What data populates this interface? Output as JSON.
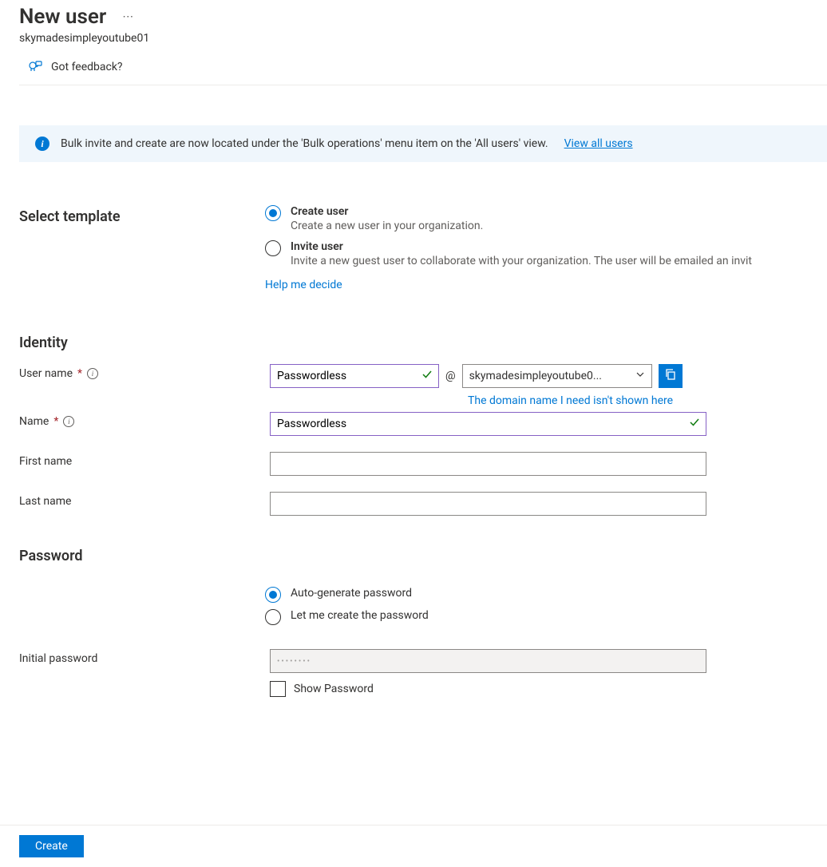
{
  "header": {
    "title": "New user",
    "subtitle": "skymadesimpleyoutube01",
    "feedback_label": "Got feedback?"
  },
  "banner": {
    "text": "Bulk invite and create are now located under the 'Bulk operations' menu item on the 'All users' view.",
    "link_label": "View all users"
  },
  "template_section": {
    "title": "Select template",
    "create": {
      "label": "Create user",
      "desc": "Create a new user in your organization."
    },
    "invite": {
      "label": "Invite user",
      "desc": "Invite a new guest user to collaborate with your organization. The user will be emailed an invit"
    },
    "help_link": "Help me decide"
  },
  "identity_section": {
    "title": "Identity",
    "username_label": "User name",
    "username_value": "Passwordless",
    "at": "@",
    "domain_value": "skymadesimpleyoutube0...",
    "domain_link": "The domain name I need isn't shown here",
    "name_label": "Name",
    "name_value": "Passwordless",
    "first_name_label": "First name",
    "first_name_value": "",
    "last_name_label": "Last name",
    "last_name_value": ""
  },
  "password_section": {
    "title": "Password",
    "auto_label": "Auto-generate password",
    "manual_label": "Let me create the password",
    "initial_label": "Initial password",
    "initial_value": "••••••••",
    "show_label": "Show Password"
  },
  "footer": {
    "create_label": "Create"
  }
}
